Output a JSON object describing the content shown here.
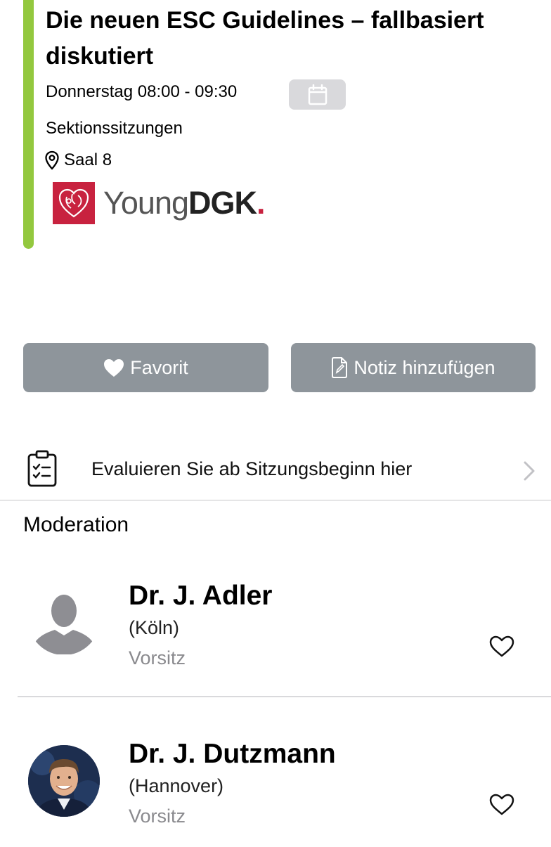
{
  "session": {
    "title": "Die neuen ESC Guidelines – fallbasiert diskutiert",
    "time": "Donnerstag 08:00 - 09:30",
    "category": "Sektionssitzungen",
    "location": "Saal 8",
    "accent_color": "#93c83e",
    "calendar_icon": "calendar-icon"
  },
  "logo": {
    "young": "Young",
    "dgk": "DGK",
    "dot": ".",
    "brand_color": "#c8223f"
  },
  "actions": {
    "favorit_label": "Favorit",
    "notiz_label": "Notiz hinzufügen",
    "button_color": "#8e959b"
  },
  "evaluation": {
    "label": "Evaluieren Sie ab Sitzungsbeginn hier",
    "icon": "clipboard-checklist-icon"
  },
  "moderation": {
    "heading": "Moderation",
    "people": [
      {
        "name": "Dr. J. Adler",
        "city": "(Köln)",
        "role": "Vorsitz",
        "avatar": "placeholder-silhouette"
      },
      {
        "name": "Dr. J. Dutzmann",
        "city": "(Hannover)",
        "role": "Vorsitz",
        "avatar": "photo"
      }
    ]
  }
}
